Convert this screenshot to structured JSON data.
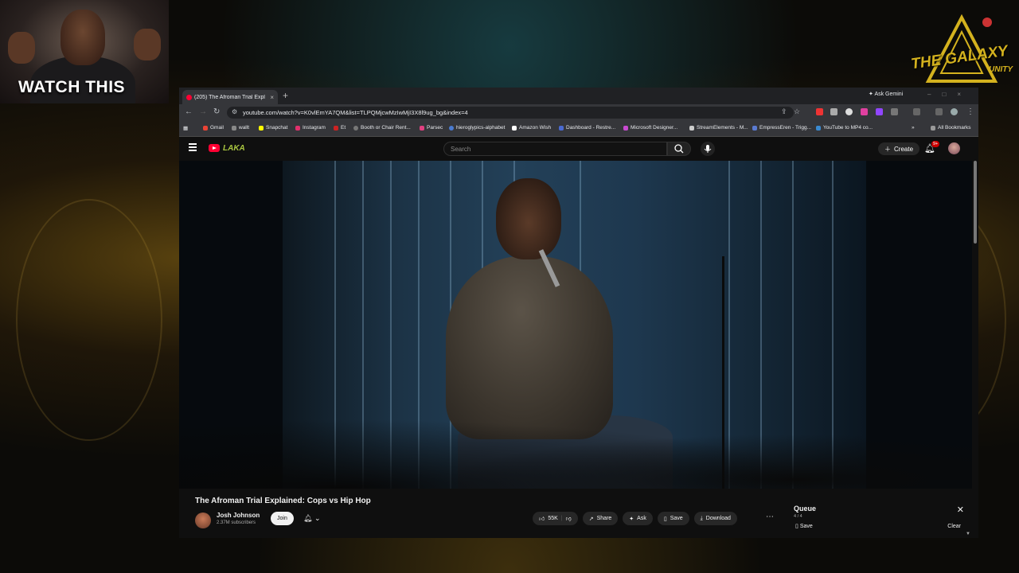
{
  "overlay": {
    "cam_label": "WATCH THIS",
    "community_logo_text": "THE GALAXY",
    "community_logo_sub": "UNITY"
  },
  "browser": {
    "tab": {
      "title": "(205) The Afroman Trial Expl",
      "close": "×"
    },
    "new_tab": "+",
    "ask_gemini": "Ask Gemini",
    "url": "youtube.com/watch?v=K0vlEmYA7QM&list=TLPQMjcwMzIwMjI3X8l9ug_bg&index=4",
    "bookmarks": [
      {
        "label": "Gmail",
        "color": "#ea4335"
      },
      {
        "label": "wallt",
        "color": "#888888"
      },
      {
        "label": "Snapchat",
        "color": "#fffc00"
      },
      {
        "label": "Instagram",
        "color": "#e1306c"
      },
      {
        "label": "Et",
        "color": "#cc2222"
      },
      {
        "label": "Booth or Chair Rent...",
        "color": "#777777"
      },
      {
        "label": "Parsec",
        "color": "#e04080"
      },
      {
        "label": "hieroglypics-alphabet",
        "color": "#4a7bd0"
      },
      {
        "label": "Amazon Wish",
        "color": "#ffffff"
      },
      {
        "label": "Dashboard - Restre...",
        "color": "#4a6ad0"
      },
      {
        "label": "Microsoft Designer...",
        "color": "#c84ad0"
      },
      {
        "label": "StreamElements - M...",
        "color": "#cccccc"
      },
      {
        "label": "EmpressEren - Trigg...",
        "color": "#5a7ad0"
      },
      {
        "label": "YouTube to MP4 co...",
        "color": "#3a8ad0"
      }
    ],
    "all_bookmarks": "All Bookmarks"
  },
  "youtube": {
    "search_placeholder": "Search",
    "create_label": "Create",
    "notification_count": "9+",
    "doodle": "LAKA",
    "video_title": "The Afroman Trial Explained: Cops vs Hip Hop",
    "channel_name": "Josh Johnson",
    "subscribers": "2.37M subscribers",
    "join_label": "Join",
    "actions": {
      "likes": "55K",
      "share": "Share",
      "ask": "Ask",
      "save": "Save",
      "download": "Download"
    },
    "queue": {
      "title": "Queue",
      "count": "4 / 4",
      "save": "Save",
      "clear": "Clear"
    }
  },
  "colors": {
    "youtube_red": "#ff0033",
    "logo_gold": "#d4b21e",
    "page_bg": "#0f0f0f"
  }
}
